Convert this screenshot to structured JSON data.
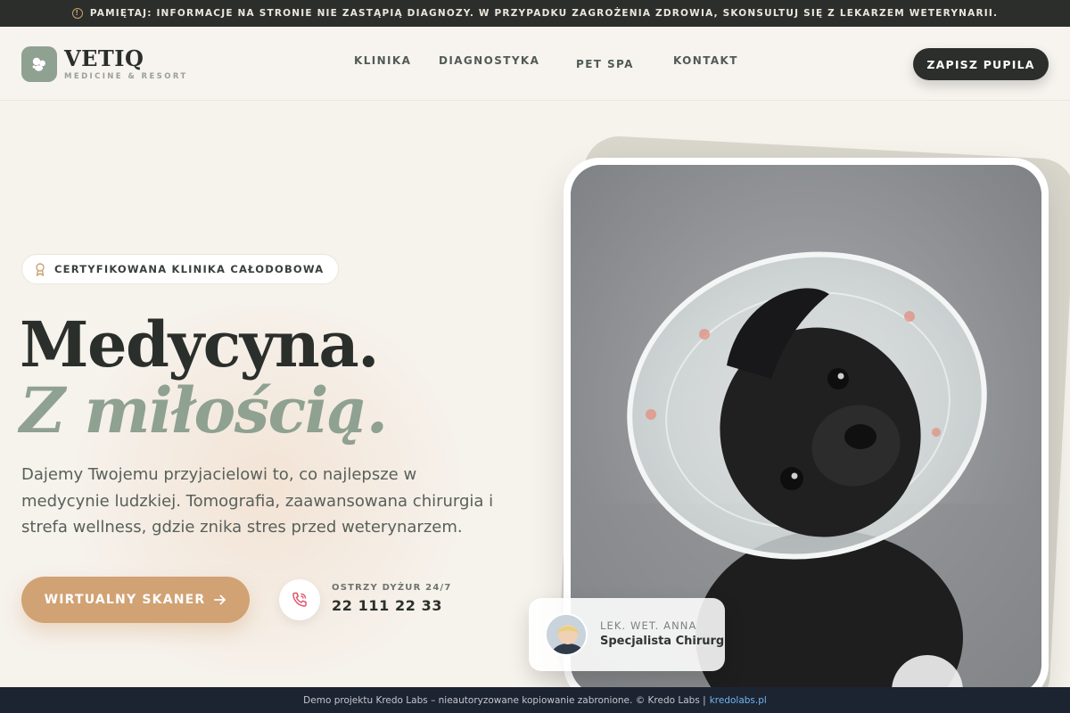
{
  "notice": {
    "text": "PAMIĘTAJ: INFORMACJE NA STRONIE NIE ZASTĄPIĄ DIAGNOZY. W PRZYPADKU ZAGROŻENIA ZDROWIA, SKONSULTUJ SIĘ Z LEKARZEM WETERYNARII.",
    "icon": "info-icon"
  },
  "header": {
    "logo_name": "VETIQ",
    "logo_sub": "MEDICINE & RESORT",
    "nav": [
      "KLINIKA",
      "DIAGNOSTYKA",
      "PET SPA",
      "KONTAKT"
    ],
    "cta": "ZAPISZ PUPILA"
  },
  "hero": {
    "badge": "CERTYFIKOWANA KLINIKA CAŁODOBOWA",
    "title_line1": "Medycyna.",
    "title_line2": "Z miłością.",
    "lead": "Dajemy Twojemu przyjacielowi to, co najlepsze w medycynie ludzkiej. Tomografia, zaawansowana chirurgia i strefa wellness, gdzie znika stres przed weterynarzem.",
    "scan_button": "WIRTUALNY SKANER",
    "duty_label": "OSTRZY DYŻUR 24/7",
    "duty_phone": "22 111 22 33"
  },
  "doctor": {
    "title": "LEK. WET. ANNA",
    "role": "Specjalista Chirurg"
  },
  "footer": {
    "text": "Demo projektu Kredo Labs – nieautoryzowane kopiowanie zabronione. © Kredo Labs |",
    "link": "kredolabs.pl"
  },
  "colors": {
    "sage": "#8fa191",
    "dark": "#2b2e2b",
    "tan": "#d1a274",
    "background": "#f6f2ec",
    "footer": "#1d2431"
  }
}
